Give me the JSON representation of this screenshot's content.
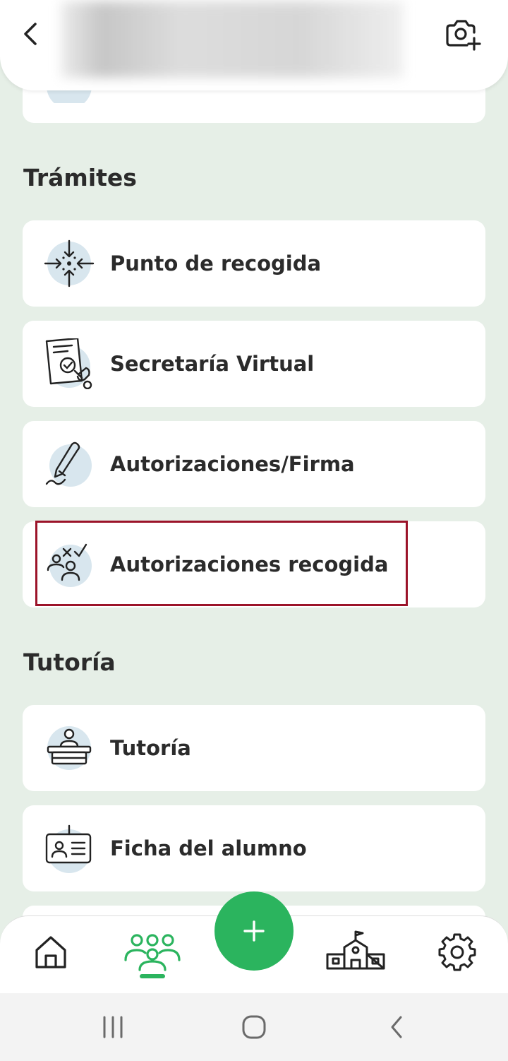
{
  "sections": [
    {
      "title": "Trámites",
      "items": [
        {
          "label": "Punto de recogida",
          "icon": "pickup-point-icon"
        },
        {
          "label": "Secretaría Virtual",
          "icon": "virtual-secretary-icon"
        },
        {
          "label": "Autorizaciones/Firma",
          "icon": "signature-icon"
        },
        {
          "label": "Autorizaciones recogida",
          "icon": "pickup-authorization-icon"
        }
      ]
    },
    {
      "title": "Tutoría",
      "items": [
        {
          "label": "Tutoría",
          "icon": "tutoring-desk-icon"
        },
        {
          "label": "Ficha del alumno",
          "icon": "student-card-icon"
        }
      ]
    }
  ],
  "bottom_nav": {
    "items": [
      "home-icon",
      "students-icon",
      "add-icon",
      "school-icon",
      "settings-icon"
    ],
    "active": "students-icon"
  },
  "colors": {
    "accent": "#2bb45e",
    "background": "#e6efe7",
    "highlight": "#9b1329",
    "icon_circle": "#d8e6ee"
  }
}
